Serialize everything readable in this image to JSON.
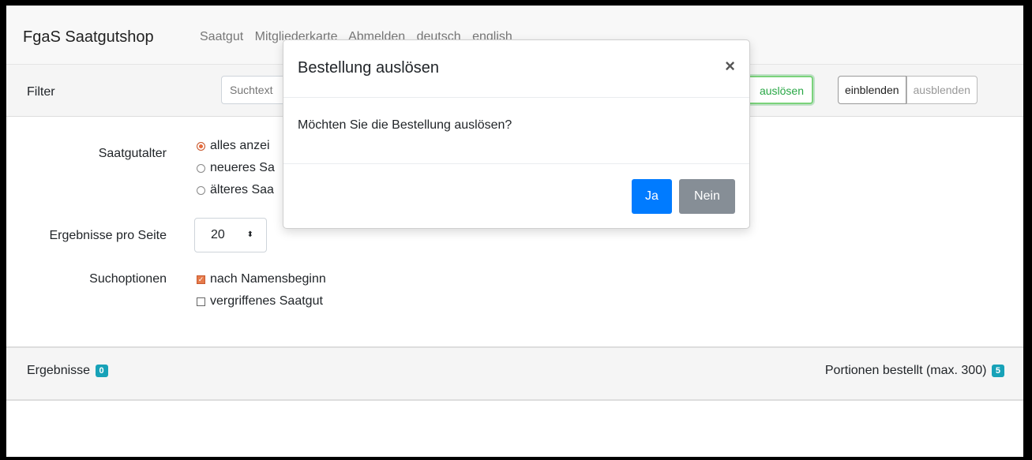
{
  "header": {
    "brand": "FgaS Saatgutshop",
    "nav": [
      "Saatgut",
      "Mitgliederkarte",
      "Abmelden",
      "deutsch",
      "english"
    ]
  },
  "filter": {
    "label": "Filter",
    "search_placeholder": "Suchtext",
    "order_button": "auslösen",
    "toggle_show": "einblenden",
    "toggle_hide": "ausblenden"
  },
  "form": {
    "seed_age_label": "Saatgutalter",
    "seed_age_options": [
      {
        "label": "alles anzei",
        "selected": true
      },
      {
        "label": "neueres Sa",
        "selected": false
      },
      {
        "label": "älteres Saa",
        "selected": false
      }
    ],
    "per_page_label": "Ergebnisse pro Seite",
    "per_page_value": "20",
    "search_options_label": "Suchoptionen",
    "search_options": [
      {
        "label": "nach Namensbeginn",
        "checked": true
      },
      {
        "label": "vergriffenes Saatgut",
        "checked": false
      }
    ]
  },
  "results": {
    "label": "Ergebnisse",
    "count": "0",
    "ordered_label": "Portionen bestellt (max. 300)",
    "ordered_count": "5"
  },
  "modal": {
    "title": "Bestellung auslösen",
    "close": "×",
    "body": "Möchten Sie die Bestellung auslösen?",
    "yes": "Ja",
    "no": "Nein"
  },
  "colors": {
    "primary": "#007bff",
    "secondary": "#868e96",
    "badge": "#17a2b8",
    "success": "#28a745",
    "accent": "#e66a3a"
  }
}
